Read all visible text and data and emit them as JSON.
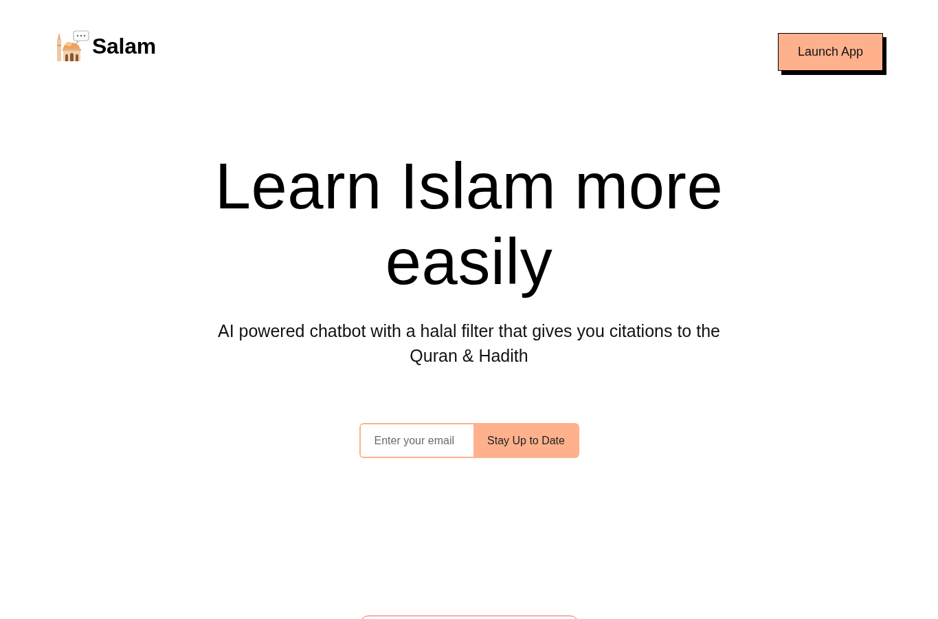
{
  "header": {
    "logo": {
      "name": "Salam"
    },
    "launch_button": "Launch App"
  },
  "hero": {
    "title": "Learn Islam more easily",
    "subtitle": "AI powered chatbot with a halal filter that gives you citations to the Quran & Hadith"
  },
  "signup": {
    "placeholder": "Enter your email",
    "button": "Stay Up to Date"
  }
}
